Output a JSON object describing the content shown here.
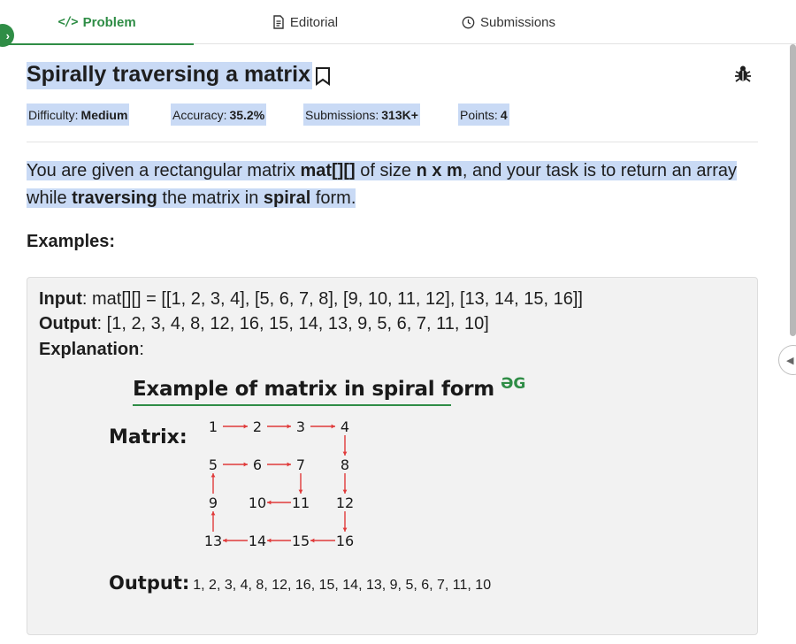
{
  "tabs": {
    "problem": "Problem",
    "editorial": "Editorial",
    "submissions": "Submissions"
  },
  "problem": {
    "title": "Spirally traversing a matrix",
    "difficulty_label": "Difficulty:",
    "difficulty": "Medium",
    "accuracy_label": "Accuracy:",
    "accuracy": "35.2%",
    "submissions_label": "Submissions:",
    "submissions": "313K+",
    "points_label": "Points:",
    "points": "4"
  },
  "description": {
    "p1": "You are given a rectangular matrix ",
    "b1": "mat[][]",
    "p2": " of size ",
    "b2": "n x m",
    "p3": ", and your task is to return an array while ",
    "b3": "traversing",
    "p4": " the matrix in ",
    "b4": "spiral",
    "p5": " form."
  },
  "examples_heading": "Examples:",
  "example": {
    "input_label": "Input",
    "input_value": ": mat[][] = [[1, 2, 3, 4], [5, 6, 7, 8], [9, 10, 11, 12], [13, 14, 15, 16]]",
    "output_label": "Output",
    "output_value": ": [1, 2, 3, 4, 8, 12, 16, 15, 14, 13, 9, 5, 6, 7, 11, 10]",
    "explanation_label": "Explanation",
    "explanation_colon": ":"
  },
  "diagram": {
    "title": "Example of matrix in spiral form",
    "logo_text": "GfG",
    "matrix_label": "Matrix:",
    "output_label": "Output:",
    "output_value": "1, 2, 3, 4, 8, 12, 16, 15, 14, 13, 9, 5, 6, 7, 11, 10",
    "matrix": [
      [
        1,
        2,
        3,
        4
      ],
      [
        5,
        6,
        7,
        8
      ],
      [
        9,
        10,
        11,
        12
      ],
      [
        13,
        14,
        15,
        16
      ]
    ]
  },
  "colors": {
    "brand_green": "#2f8d46",
    "highlight": "#c9daf5",
    "arrow_red": "#e03a3a"
  }
}
